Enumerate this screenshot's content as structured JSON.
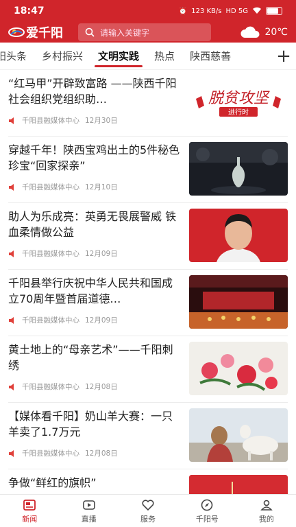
{
  "status_bar": {
    "time": "18:47",
    "network": "123 KB/s",
    "signal": "HD 5G"
  },
  "header": {
    "app_name": "爱千阳",
    "search_placeholder": "请输入关键字",
    "temperature": "20℃",
    "weather_icon": "cloud-icon"
  },
  "tabs": [
    {
      "label": "阳头条"
    },
    {
      "label": "乡村振兴"
    },
    {
      "label": "文明实践",
      "active": true
    },
    {
      "label": "热点"
    },
    {
      "label": "陕西慈善"
    }
  ],
  "articles": [
    {
      "title": "“红马甲”开辟致富路 ——陕西千阳社会组织党组织助…",
      "source": "千阳县融媒体中心",
      "date": "12月30日",
      "image": "脱贫攻坚进行时 banner",
      "image_text_1": "脱贫攻坚",
      "image_text_2": "进行时"
    },
    {
      "title": "穿越千年！陕西宝鸡出土的5件秘色珍宝“回家探亲”",
      "source": "千阳县融媒体中心",
      "date": "12月10日",
      "image": "celadon vase on display"
    },
    {
      "title": "助人为乐成亮：英勇无畏展警威 铁血柔情做公益",
      "source": "千阳县融媒体中心",
      "date": "12月09日",
      "image": "portrait of young man"
    },
    {
      "title": "千阳县举行庆祝中华人民共和国成立70周年暨首届道德…",
      "source": "千阳县融媒体中心",
      "date": "12月09日",
      "image": "stage ceremony"
    },
    {
      "title": "黄土地上的“母亲艺术”——千阳刺绣",
      "source": "千阳县融媒体中心",
      "date": "12月08日",
      "image": "peony embroidery"
    },
    {
      "title": "【媒体看千阳】奶山羊大赛：一只羊卖了1.7万元",
      "source": "千阳县融媒体中心",
      "date": "12月08日",
      "image": "farmer with goat"
    },
    {
      "title": "争做“鲜红的旗帜”",
      "source": "",
      "date": "",
      "image": "flag"
    }
  ],
  "bottom_nav": [
    {
      "label": "新闻",
      "icon": "news-icon",
      "active": true
    },
    {
      "label": "直播",
      "icon": "live-icon"
    },
    {
      "label": "服务",
      "icon": "service-icon"
    },
    {
      "label": "千阳号",
      "icon": "compass-icon"
    },
    {
      "label": "我的",
      "icon": "user-icon"
    }
  ],
  "colors": {
    "brand": "#d0252b",
    "text": "#222222",
    "meta": "#999999"
  }
}
